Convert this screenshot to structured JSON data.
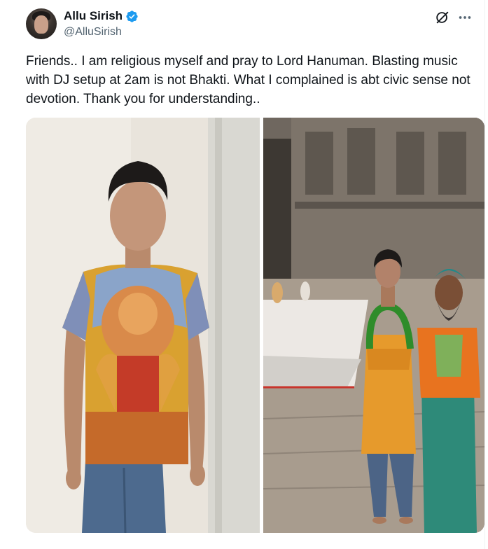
{
  "tweet": {
    "author": {
      "display_name": "Allu Sirish",
      "handle": "@AlluSirish",
      "verified": true,
      "avatar_icon": "profile-avatar"
    },
    "text": "Friends.. I am religious myself and pray to Lord Hanuman. Blasting music with DJ setup at 2am is not Bhakti. What I complained is abt civic sense not devotion. Thank you for understanding..",
    "actions": {
      "grok_icon": "grok-icon",
      "more_icon": "more-icon"
    },
    "media": [
      {
        "description_icon": "photo-hanuman-tshirt"
      },
      {
        "description_icon": "photo-temple-with-priest"
      }
    ]
  },
  "colors": {
    "verified_blue": "#1d9bf0",
    "text_primary": "#0f1419",
    "text_secondary": "#536471"
  }
}
